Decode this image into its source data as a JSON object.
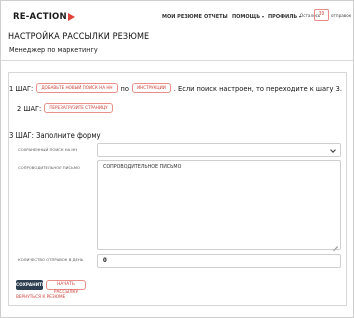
{
  "brand": {
    "logo_text": "RE-ACTION",
    "accent_color": "#e0413a"
  },
  "nav": {
    "items": [
      {
        "label": "МОИ РЕЗЮМЕ"
      },
      {
        "label": "ОТЧЕТЫ"
      },
      {
        "label": "ПОМОЩЬ"
      },
      {
        "label": "ПРОФИЛЬ"
      }
    ],
    "remaining": {
      "prefix": "Осталось",
      "value": "30",
      "suffix": "отправок"
    }
  },
  "page": {
    "title": "НАСТРОЙКА РАССЫЛКИ РЕЗЮМЕ",
    "subtitle": "Менеджер по маркетингу"
  },
  "steps": {
    "step1": {
      "prefix": "1 ШАГ:",
      "add_search_button": "ДОБАВЬТЕ НОВЫЙ ПОИСК НА НН",
      "by": "по",
      "instruction_button": "ИНСТРУКЦИИ",
      "note": ". Если поиск настроен, то переходите к шагу 3."
    },
    "step2": {
      "prefix": "2 ШАГ:",
      "reload_button": "ПЕРЕЗАГРУЗИТЕ СТРАНИЦУ"
    },
    "step3": {
      "title": "3 ШАГ: Заполните форму"
    }
  },
  "form": {
    "saved_search": {
      "label": "СОХРАНЕННЫЙ ПОИСК НА НН",
      "value": ""
    },
    "cover_letter": {
      "label": "СОПРОВОДИТЕЛЬНОЕ ПИСЬМО",
      "value": "СОПРОВОДИТЕЛЬНОЕ ПИСЬМО"
    },
    "sends_per_day": {
      "label": "КОЛИЧЕСТВО ОТПРАВОК В ДЕНЬ",
      "value": "0"
    },
    "save_button": "СОХРАНИТЬ",
    "start_button": "НАЧАТЬ РАССЫЛКУ",
    "back_link": "ВЕРНУТЬСЯ К РЕЗЮМЕ"
  }
}
